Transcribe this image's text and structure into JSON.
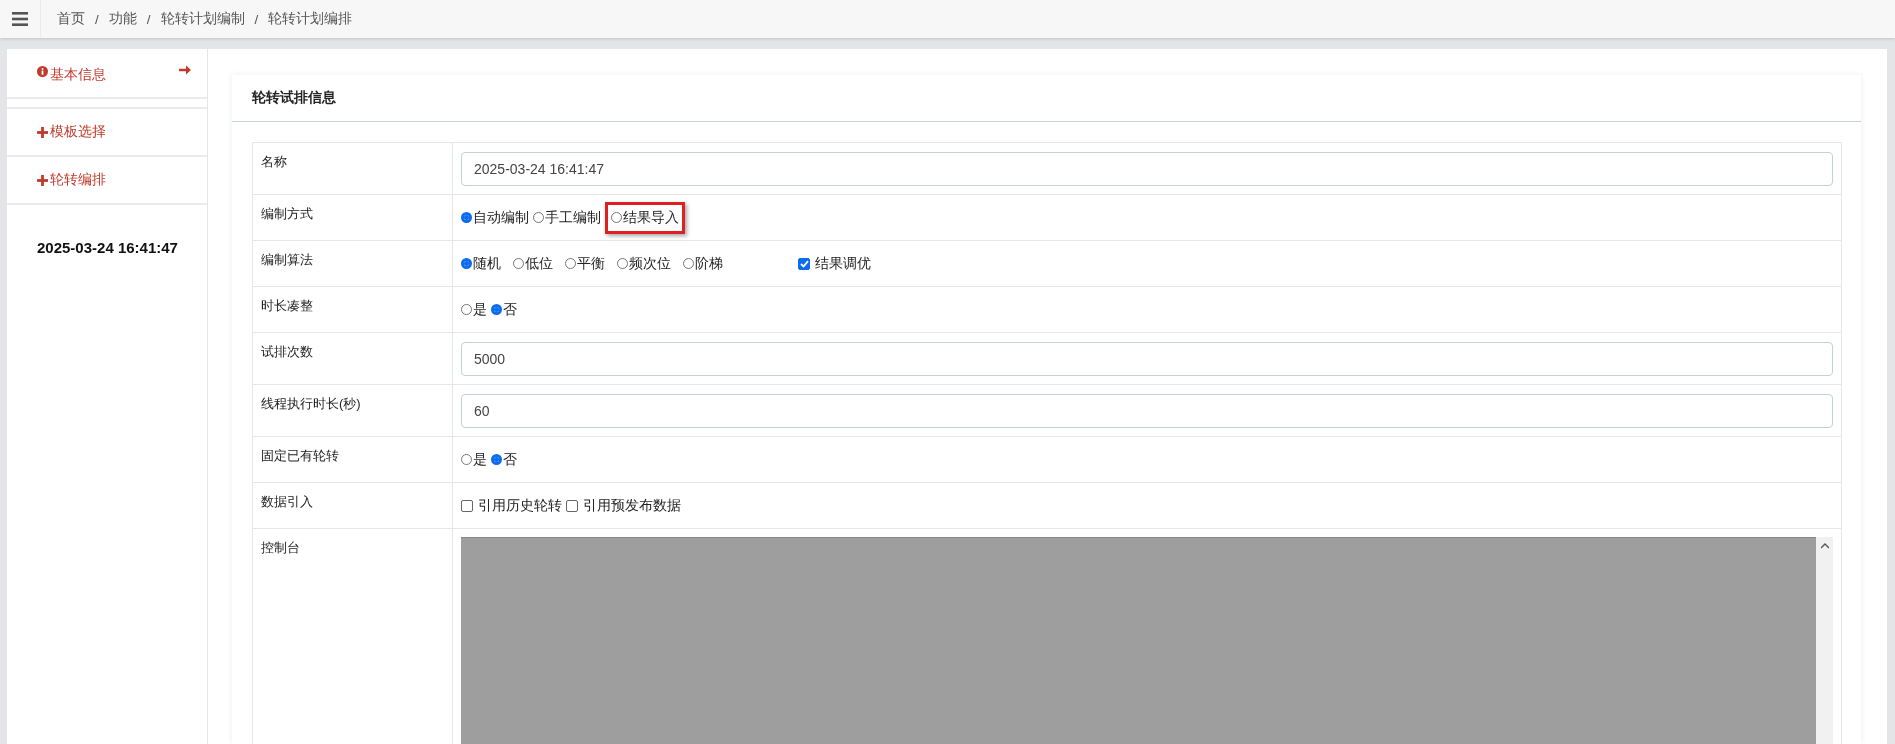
{
  "breadcrumb": {
    "separator": "/",
    "items": [
      "首页",
      "功能",
      "轮转计划编制",
      "轮转计划编排"
    ]
  },
  "sidebar": {
    "items": [
      {
        "label": "基本信息",
        "kind": "info",
        "selected": true
      },
      {
        "label": "模板选择",
        "kind": "plus",
        "selected": false
      },
      {
        "label": "轮转编排",
        "kind": "plus",
        "selected": false
      }
    ],
    "footer_title": "2025-03-24 16:41:47"
  },
  "card": {
    "title": "轮转试排信息",
    "rows": [
      {
        "kind": "text",
        "label": "名称",
        "value": "2025-03-24 16:41:47"
      },
      {
        "kind": "radio",
        "label": "编制方式",
        "options": [
          {
            "label": "自动编制",
            "selected": true,
            "highlighted": false
          },
          {
            "label": "手工编制",
            "selected": false,
            "highlighted": false
          },
          {
            "label": "结果导入",
            "selected": false,
            "highlighted": true
          }
        ]
      },
      {
        "kind": "radio",
        "label": "编制算法",
        "options": [
          {
            "label": "随机",
            "selected": true,
            "highlighted": false
          },
          {
            "label": "低位",
            "selected": false,
            "highlighted": false
          },
          {
            "label": "平衡",
            "selected": false,
            "highlighted": false
          },
          {
            "label": "频次位",
            "selected": false,
            "highlighted": false
          },
          {
            "label": "阶梯",
            "selected": false,
            "highlighted": false
          }
        ],
        "checkboxes": [
          {
            "label": "结果调优",
            "checked": true
          }
        ]
      },
      {
        "kind": "radio",
        "label": "时长凑整",
        "options": [
          {
            "label": "是",
            "selected": false,
            "highlighted": false
          },
          {
            "label": "否",
            "selected": true,
            "highlighted": false
          }
        ]
      },
      {
        "kind": "text",
        "label": "试排次数",
        "value": "5000"
      },
      {
        "kind": "text",
        "label": "线程执行时长(秒)",
        "value": "60"
      },
      {
        "kind": "radio",
        "label": "固定已有轮转",
        "options": [
          {
            "label": "是",
            "selected": false,
            "highlighted": false
          },
          {
            "label": "否",
            "selected": true,
            "highlighted": false
          }
        ]
      },
      {
        "kind": "checkbox",
        "label": "数据引入",
        "checkboxes": [
          {
            "label": "引用历史轮转",
            "checked": false
          },
          {
            "label": "引用预发布数据",
            "checked": false
          }
        ]
      },
      {
        "kind": "console",
        "label": "控制台"
      }
    ]
  }
}
